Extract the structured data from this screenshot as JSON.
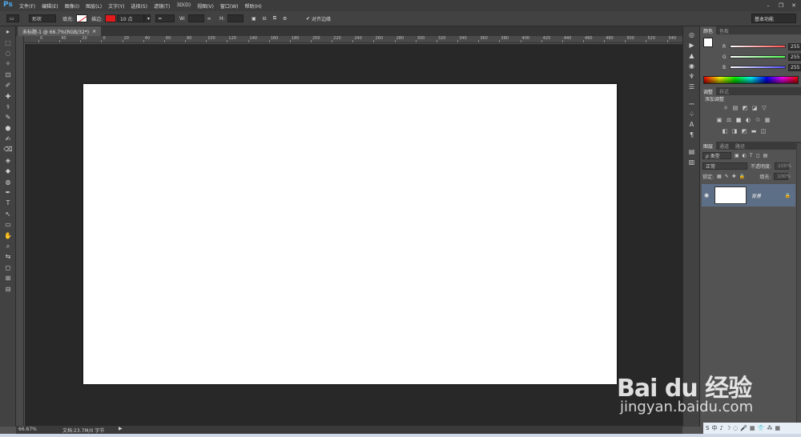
{
  "app": {
    "logo": "Ps",
    "menus": [
      "文件(F)",
      "编辑(E)",
      "图像(I)",
      "图层(L)",
      "文字(Y)",
      "选择(S)",
      "滤镜(T)",
      "3D(D)",
      "视图(V)",
      "窗口(W)",
      "帮助(H)"
    ],
    "window_controls": [
      "–",
      "❐",
      "✕"
    ]
  },
  "options": {
    "shape_mode": "形状",
    "fill_label": "填充:",
    "stroke_label": "描边:",
    "stroke_size": "10 点",
    "w_label": "W:",
    "h_label": "H:",
    "align_edges_label": "对齐边缘",
    "workspace": "基本功能"
  },
  "document": {
    "tab_title": "未标题-1 @ 66.7%(RGB/32*)",
    "tab_close": "×",
    "ruler_h": [
      "0",
      "40",
      "20",
      "0",
      "20",
      "40",
      "60",
      "80",
      "100",
      "120",
      "140",
      "160",
      "180",
      "200",
      "220",
      "240",
      "260",
      "280",
      "300",
      "320",
      "340",
      "360",
      "380",
      "400",
      "420",
      "440",
      "460",
      "480",
      "500",
      "520",
      "540",
      "560",
      "580",
      "600",
      "620",
      "640",
      "660",
      "680",
      "700",
      "720",
      "740",
      "760",
      "780",
      "800",
      "820",
      "840",
      "860",
      "880",
      "900",
      "920",
      "940",
      "960",
      "980",
      "1000",
      "1020",
      "1040",
      "1060",
      "1080",
      "1100",
      "1120",
      "1140",
      "1160",
      "1180",
      "1200",
      "1220",
      "1240"
    ]
  },
  "status": {
    "zoom": "66.67%",
    "doc_info": "文档:23.7M/0 字节",
    "arrow": "▶"
  },
  "color_panel": {
    "tabs": [
      "颜色",
      "色板"
    ],
    "channels": [
      {
        "label": "R",
        "value": "255",
        "color": "#ff4d4d"
      },
      {
        "label": "G",
        "value": "255",
        "color": "#4dff4d"
      },
      {
        "label": "B",
        "value": "255",
        "color": "#4d4dff"
      }
    ],
    "foreground": "#ffffff",
    "background": "#7fd6d0"
  },
  "adjustments_panel": {
    "tabs": [
      "调整",
      "样式"
    ],
    "title": "添加调整",
    "row1": [
      "☼",
      "▤",
      "◩",
      "◪",
      "▽"
    ],
    "row2": [
      "▣",
      "⚖",
      "■",
      "◐",
      "♲",
      "▦"
    ],
    "row3": [
      "◧",
      "◨",
      "◩",
      "▬",
      "◫"
    ]
  },
  "layers_panel": {
    "tabs": [
      "图层",
      "通道",
      "路径"
    ],
    "filter_kind": "ρ 类型",
    "blend_mode": "正常",
    "opacity_label": "不透明度:",
    "opacity_value": "100%",
    "lock_label": "锁定:",
    "fill_label": "填充:",
    "fill_value": "100%",
    "layers": [
      {
        "name": "背景",
        "visible_icon": "◉",
        "lock_icon": "🔒"
      }
    ]
  },
  "tools": [
    "▸",
    "⬚",
    "◌",
    "✧",
    "⊡",
    "✐",
    "✚",
    "⚕",
    "✎",
    "⬢",
    "✍",
    "⌫",
    "◈",
    "◆",
    "◍",
    "✒",
    "T",
    "↖",
    "▭",
    "✋",
    "⌕",
    "⇆",
    "◻",
    "⊞",
    "⊟"
  ],
  "icon_strip": [
    "◎",
    "▶",
    "▲",
    "◉",
    "♆",
    "☰",
    "⎓",
    "♤",
    "A",
    "¶",
    "▤",
    "▥"
  ],
  "watermark": {
    "brand": "Bai du 经验",
    "url": "jingyan.baidu.com"
  },
  "tray": [
    "S",
    "中",
    "♪",
    "☽",
    "◌",
    "🎤",
    "▦",
    "👕",
    "⁂",
    "▦"
  ]
}
